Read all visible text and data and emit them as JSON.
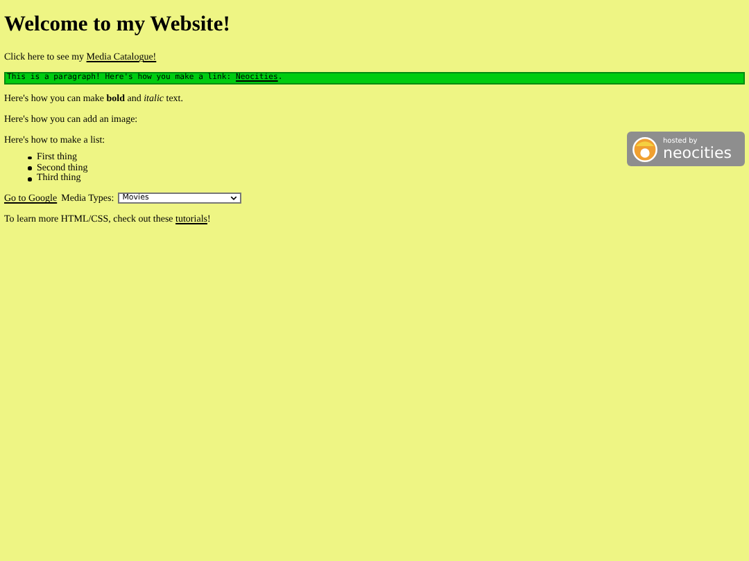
{
  "heading": "Welcome to my Website!",
  "catalogue_line": {
    "text": "Click here to see my ",
    "link": "Media Catalogue!"
  },
  "code_paragraph": {
    "text": "This is a paragraph! Here's how you make a link: ",
    "link": "Neocities",
    "after": "."
  },
  "format_line": "Here's how you can make **bold** and *italic* text.",
  "image_line": "Here's how you can add an image:",
  "badge": {
    "small": "hosted by",
    "big": "neocities"
  },
  "list_intro": "Here's how to make a list:",
  "list": [
    "First thing",
    "Second thing",
    "Third thing"
  ],
  "google_link": "Go to Google",
  "media_label": "Media Types:",
  "media_select": {
    "value": "Movies"
  },
  "learn_line": {
    "text": "To learn more HTML/CSS, check out these ",
    "link": "tutorials",
    "after": "!"
  }
}
